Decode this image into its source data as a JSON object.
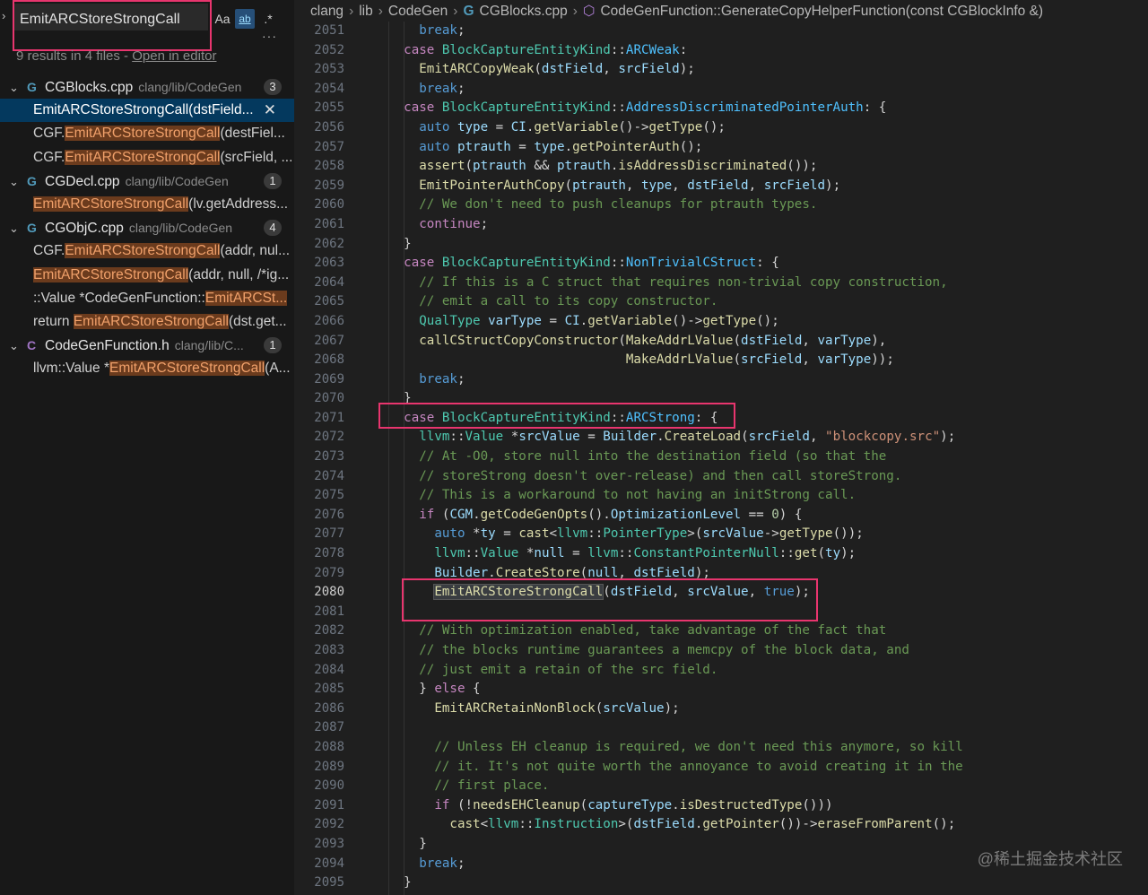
{
  "search": {
    "query": "EmitARCStoreStrongCall",
    "match_case_label": "Aa",
    "whole_word_label": "ab",
    "regex_label": ".*",
    "more_label": "···",
    "summary": "9 results in 4 files - ",
    "open_in_editor": "Open in editor"
  },
  "results": [
    {
      "file": "CGBlocks.cpp",
      "icon": "cpp",
      "path": "clang/lib/CodeGen",
      "count": "3",
      "matches": [
        {
          "pre": "",
          "hit": "EmitARCStoreStrongCall",
          "post": "(dstField...",
          "selected": true
        },
        {
          "pre": "CGF.",
          "hit": "EmitARCStoreStrongCall",
          "post": "(destFiel...",
          "selected": false
        },
        {
          "pre": "CGF.",
          "hit": "EmitARCStoreStrongCall",
          "post": "(srcField, ...",
          "selected": false
        }
      ]
    },
    {
      "file": "CGDecl.cpp",
      "icon": "cpp",
      "path": "clang/lib/CodeGen",
      "count": "1",
      "matches": [
        {
          "pre": "",
          "hit": "EmitARCStoreStrongCall",
          "post": "(lv.getAddress...",
          "selected": false
        }
      ]
    },
    {
      "file": "CGObjC.cpp",
      "icon": "cpp",
      "path": "clang/lib/CodeGen",
      "count": "4",
      "matches": [
        {
          "pre": "CGF.",
          "hit": "EmitARCStoreStrongCall",
          "post": "(addr, nul...",
          "selected": false
        },
        {
          "pre": "",
          "hit": "EmitARCStoreStrongCall",
          "post": "(addr, null, /*ig...",
          "selected": false
        },
        {
          "pre": "::Value *CodeGenFunction::",
          "hit": "EmitARCSt...",
          "post": "",
          "selected": false
        },
        {
          "pre": "return ",
          "hit": "EmitARCStoreStrongCall",
          "post": "(dst.get...",
          "selected": false
        }
      ]
    },
    {
      "file": "CodeGenFunction.h",
      "icon": "h",
      "path": "clang/lib/C...",
      "count": "1",
      "matches": [
        {
          "pre": "llvm::Value *",
          "hit": "EmitARCStoreStrongCall",
          "post": "(A...",
          "selected": false
        }
      ]
    }
  ],
  "breadcrumb": {
    "items": [
      "clang",
      "lib",
      "CodeGen"
    ],
    "file": "CGBlocks.cpp",
    "symbol": "CodeGenFunction::GenerateCopyHelperFunction(const CGBlockInfo &)"
  },
  "editor": {
    "current_line": 2080,
    "lines": [
      {
        "n": 2051,
        "src": "      <k>break</k>;"
      },
      {
        "n": 2052,
        "src": "    <ck>case</ck> <t>BlockCaptureEntityKind</t>::<e>ARCWeak</e>:"
      },
      {
        "n": 2053,
        "src": "      <f>EmitARCCopyWeak</f>(<v>dstField</v>, <v>srcField</v>);"
      },
      {
        "n": 2054,
        "src": "      <k>break</k>;"
      },
      {
        "n": 2055,
        "src": "    <ck>case</ck> <t>BlockCaptureEntityKind</t>::<e>AddressDiscriminatedPointerAuth</e>: {"
      },
      {
        "n": 2056,
        "src": "      <k>auto</k> <v>type</v> = <v>CI</v>.<f>getVariable</f>()-><f>getType</f>();"
      },
      {
        "n": 2057,
        "src": "      <k>auto</k> <v>ptrauth</v> = <v>type</v>.<f>getPointerAuth</f>();"
      },
      {
        "n": 2058,
        "src": "      <f>assert</f>(<v>ptrauth</v> && <v>ptrauth</v>.<f>isAddressDiscriminated</f>());"
      },
      {
        "n": 2059,
        "src": "      <f>EmitPointerAuthCopy</f>(<v>ptrauth</v>, <v>type</v>, <v>dstField</v>, <v>srcField</v>);"
      },
      {
        "n": 2060,
        "src": "      <c>// We don't need to push cleanups for ptrauth types.</c>"
      },
      {
        "n": 2061,
        "src": "      <ck>continue</ck>;"
      },
      {
        "n": 2062,
        "src": "    }"
      },
      {
        "n": 2063,
        "src": "    <ck>case</ck> <t>BlockCaptureEntityKind</t>::<e>NonTrivialCStruct</e>: {"
      },
      {
        "n": 2064,
        "src": "      <c>// If this is a C struct that requires non-trivial copy construction,</c>"
      },
      {
        "n": 2065,
        "src": "      <c>// emit a call to its copy constructor.</c>"
      },
      {
        "n": 2066,
        "src": "      <t>QualType</t> <v>varType</v> = <v>CI</v>.<f>getVariable</f>()-><f>getType</f>();"
      },
      {
        "n": 2067,
        "src": "      <f>callCStructCopyConstructor</f>(<f>MakeAddrLValue</f>(<v>dstField</v>, <v>varType</v>),"
      },
      {
        "n": 2068,
        "src": "                                 <f>MakeAddrLValue</f>(<v>srcField</v>, <v>varType</v>));"
      },
      {
        "n": 2069,
        "src": "      <k>break</k>;"
      },
      {
        "n": 2070,
        "src": "    }"
      },
      {
        "n": 2071,
        "src": "    <ck>case</ck> <t>BlockCaptureEntityKind</t>::<e>ARCStrong</e>: {"
      },
      {
        "n": 2072,
        "src": "      <t>llvm</t>::<t>Value</t> *<v>srcValue</v> = <v>Builder</v>.<f>CreateLoad</f>(<v>srcField</v>, <s>\"blockcopy.src\"</s>);"
      },
      {
        "n": 2073,
        "src": "      <c>// At -O0, store null into the destination field (so that the</c>"
      },
      {
        "n": 2074,
        "src": "      <c>// storeStrong doesn't over-release) and then call storeStrong.</c>"
      },
      {
        "n": 2075,
        "src": "      <c>// This is a workaround to not having an initStrong call.</c>"
      },
      {
        "n": 2076,
        "src": "      <ck>if</ck> (<v>CGM</v>.<f>getCodeGenOpts</f>().<v>OptimizationLevel</v> == <n>0</n>) {"
      },
      {
        "n": 2077,
        "src": "        <k>auto</k> *<v>ty</v> = <f>cast</f><<t>llvm</t>::<t>PointerType</t>>(<v>srcValue</v>-><f>getType</f>());"
      },
      {
        "n": 2078,
        "src": "        <t>llvm</t>::<t>Value</t> *<v>null</v> = <t>llvm</t>::<t>ConstantPointerNull</t>::<f>get</f>(<v>ty</v>);"
      },
      {
        "n": 2079,
        "src": "        <v>Builder</v>.<f>CreateStore</f>(<v>null</v>, <v>dstField</v>);"
      },
      {
        "n": 2080,
        "src": "        <hl><f>EmitARCStoreStrongCall</f></hl>(<v>dstField</v>, <v>srcValue</v>, <k>true</k>);"
      },
      {
        "n": 2081,
        "src": ""
      },
      {
        "n": 2082,
        "src": "      <c>// With optimization enabled, take advantage of the fact that</c>"
      },
      {
        "n": 2083,
        "src": "      <c>// the blocks runtime guarantees a memcpy of the block data, and</c>"
      },
      {
        "n": 2084,
        "src": "      <c>// just emit a retain of the src field.</c>"
      },
      {
        "n": 2085,
        "src": "      } <ck>else</ck> {"
      },
      {
        "n": 2086,
        "src": "        <f>EmitARCRetainNonBlock</f>(<v>srcValue</v>);"
      },
      {
        "n": 2087,
        "src": ""
      },
      {
        "n": 2088,
        "src": "        <c>// Unless EH cleanup is required, we don't need this anymore, so kill</c>"
      },
      {
        "n": 2089,
        "src": "        <c>// it. It's not quite worth the annoyance to avoid creating it in the</c>"
      },
      {
        "n": 2090,
        "src": "        <c>// first place.</c>"
      },
      {
        "n": 2091,
        "src": "        <ck>if</ck> (!<f>needsEHCleanup</f>(<v>captureType</v>.<f>isDestructedType</f>()))"
      },
      {
        "n": 2092,
        "src": "          <f>cast</f><<t>llvm</t>::<t>Instruction</t>>(<v>dstField</v>.<f>getPointer</f>())-><f>eraseFromParent</f>();"
      },
      {
        "n": 2093,
        "src": "      }"
      },
      {
        "n": 2094,
        "src": "      <k>break</k>;"
      },
      {
        "n": 2095,
        "src": "    }"
      }
    ]
  },
  "watermark": "@稀土掘金技术社区",
  "colors": {
    "highlight_box": "#e8356e",
    "selection": "#04395e",
    "match_bg": "#6b3b1d"
  }
}
